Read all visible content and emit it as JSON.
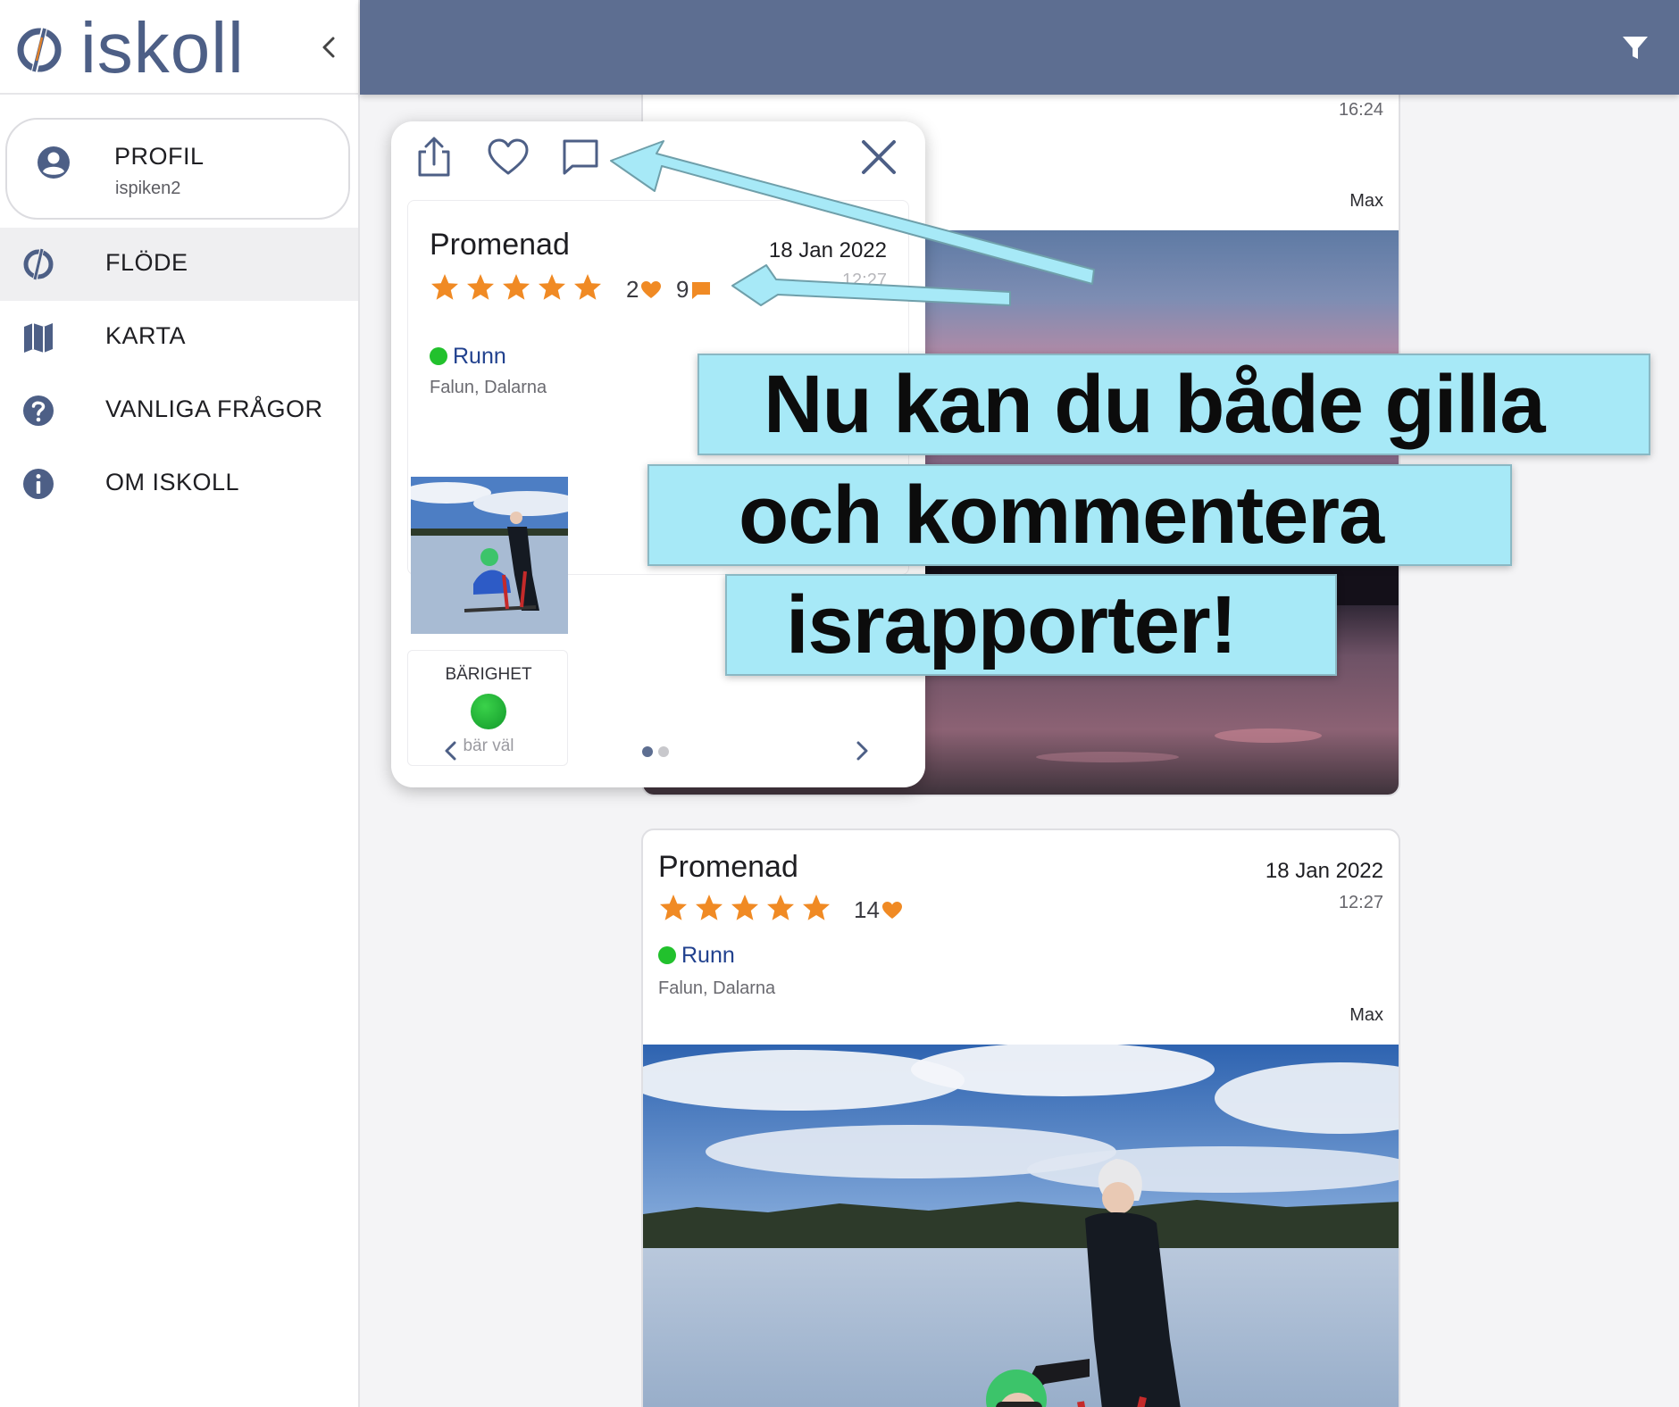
{
  "app": {
    "logo_text": "iskoll",
    "colors": {
      "header": "#5d6e91",
      "logo": "#4d5f86",
      "star": "#f08a24",
      "status": "#22c12d",
      "callout": "#a7e9f7",
      "link": "#21418e"
    }
  },
  "sidebar": {
    "profile": {
      "label": "PROFIL",
      "username": "ispiken2",
      "icon": "user-circle-icon"
    },
    "items": [
      {
        "label": "FLÖDE",
        "icon": "iskoll-feed-icon",
        "active": true
      },
      {
        "label": "KARTA",
        "icon": "map-icon",
        "active": false
      },
      {
        "label": "VANLIGA FRÅGOR",
        "icon": "question-circle-icon",
        "active": false
      },
      {
        "label": "OM ISKOLL",
        "icon": "info-circle-icon",
        "active": false
      }
    ]
  },
  "header": {
    "filter_icon": "filter-icon"
  },
  "feed": {
    "card1": {
      "time": "16:24",
      "author": "Max"
    },
    "card2": {
      "title": "Promenad",
      "date": "18 Jan 2022",
      "time": "12:27",
      "rating": 5,
      "likes": "14",
      "location": "Runn",
      "region": "Falun, Dalarna",
      "author": "Max"
    }
  },
  "popup": {
    "actions": [
      "share-icon",
      "heart-icon",
      "comment-icon",
      "close-icon"
    ],
    "title": "Promenad",
    "date": "18 Jan 2022",
    "time": "12:27",
    "rating": 5,
    "likes": "2",
    "comments": "9",
    "location": "Runn",
    "region": "Falun, Dalarna",
    "bearing": {
      "title": "BÄRIGHET",
      "value": "bär väl"
    },
    "pager": {
      "pages": 2,
      "current": 1
    }
  },
  "callout": {
    "line1": "Nu kan du både gilla",
    "line2": "och kommentera",
    "line3": "israpporter!"
  }
}
